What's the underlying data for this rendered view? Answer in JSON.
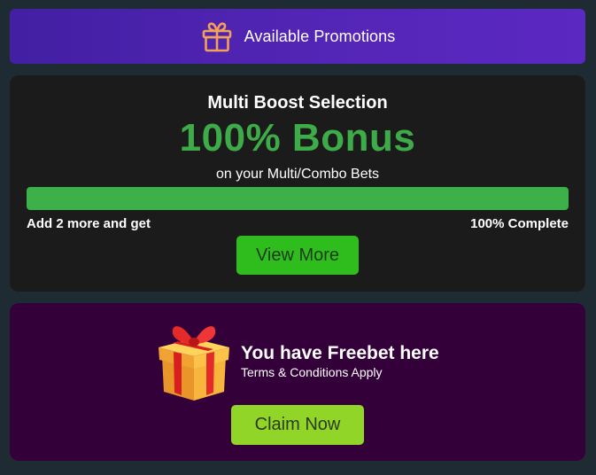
{
  "promotions_bar": {
    "icon": "gift-icon",
    "title": "Available Promotions"
  },
  "multi_boost": {
    "heading": "Multi Boost Selection",
    "bonus": "100% Bonus",
    "subtitle": "on your Multi/Combo Bets",
    "progress_percent": 100,
    "left_note": "Add 2 more and get",
    "right_note": "100% Complete",
    "button_label": "View More",
    "colors": {
      "bonus_text": "#3dab47",
      "progress_fill": "#3cb049",
      "button": "#2ebd1c"
    }
  },
  "freebet": {
    "icon": "gift-box-icon",
    "title": "You have Freebet here",
    "terms": "Terms & Conditions Apply",
    "button_label": "Claim Now",
    "colors": {
      "background": "#34003a",
      "button": "#92d529"
    }
  }
}
